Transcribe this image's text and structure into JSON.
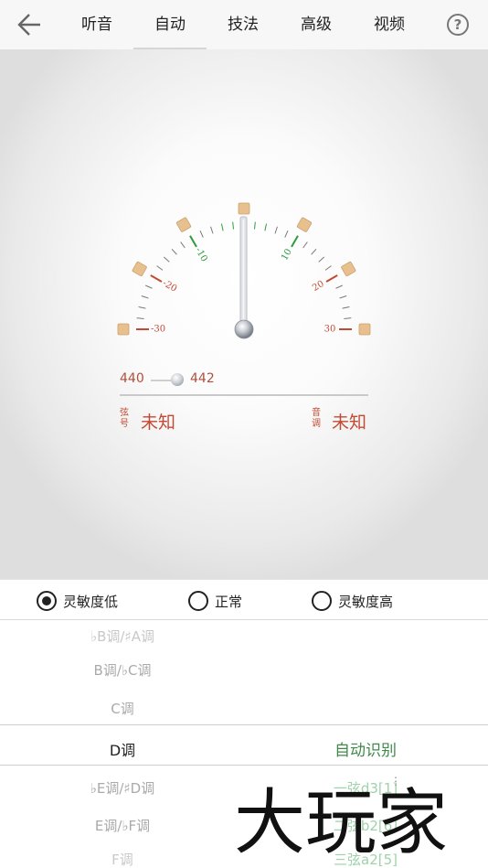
{
  "nav": {
    "tabs": [
      {
        "label": "听音"
      },
      {
        "label": "自动"
      },
      {
        "label": "技法"
      },
      {
        "label": "高级"
      },
      {
        "label": "视频"
      }
    ],
    "active_tab": "自动",
    "help_label": "?"
  },
  "tuner": {
    "scale_labels": [
      "-30",
      "-20",
      "-10",
      "10",
      "20",
      "30"
    ],
    "reference_low": "440",
    "reference_high": "442",
    "string_label": "弦号",
    "string_value": "未知",
    "pitch_label": "音调",
    "pitch_value": "未知"
  },
  "sensitivity": {
    "options": [
      {
        "label": "灵敏度低",
        "checked": true
      },
      {
        "label": "正常",
        "checked": false
      },
      {
        "label": "灵敏度高",
        "checked": false
      }
    ]
  },
  "key_picker": {
    "items": [
      {
        "label": "♭B调/♯A调"
      },
      {
        "label": "B调/♭C调"
      },
      {
        "label": "C调"
      },
      {
        "label": "D调"
      },
      {
        "label": "♭E调/♯D调"
      },
      {
        "label": "E调/♭F调"
      },
      {
        "label": "F调"
      }
    ],
    "selected": "D调"
  },
  "string_picker": {
    "items": [
      {
        "label": "自动识别"
      },
      {
        "label": "一弦d3[1]"
      },
      {
        "label": "二弦b2[6]"
      },
      {
        "label": "三弦a2[5]"
      }
    ],
    "selected": "自动识别"
  },
  "watermark_text": "大玩家",
  "colors": {
    "accent_red": "#c24a33",
    "accent_green": "#3f8a4a",
    "tick_green": "#2e9b3c",
    "marker_tan": "#e8c08e"
  }
}
